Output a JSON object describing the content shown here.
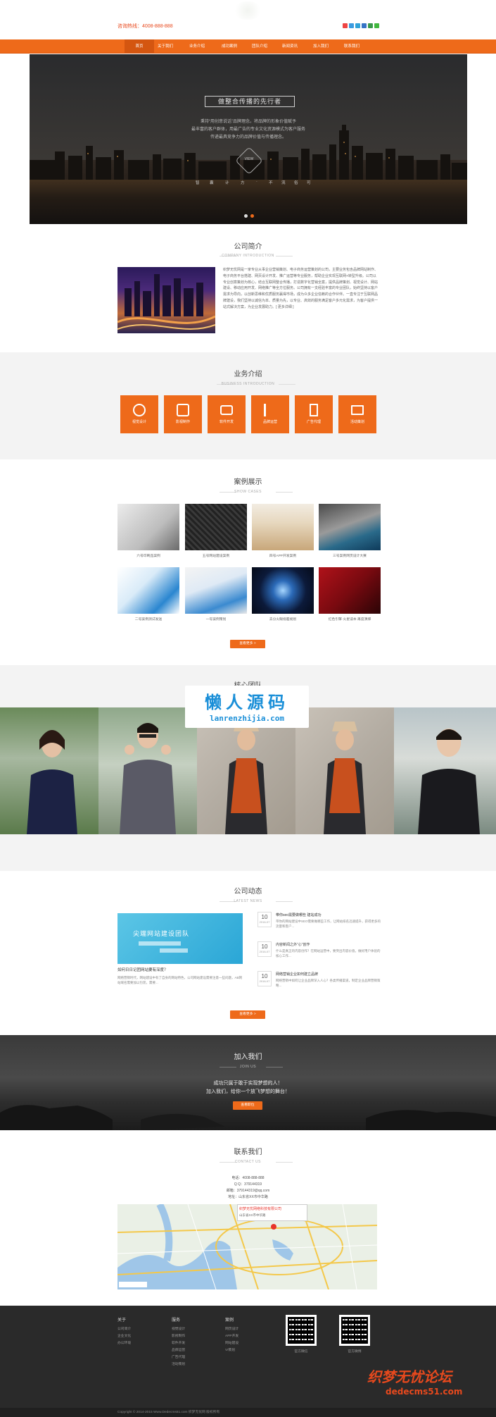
{
  "header": {
    "hotline": "咨询热线：4008-888-888",
    "social_icons": [
      "weibo-icon",
      "qq-icon",
      "tencent-icon",
      "renren-icon",
      "douban-icon",
      "wechat-icon"
    ]
  },
  "nav": {
    "items": [
      "首页",
      "关于我们",
      "业务介绍",
      "成功案例",
      "团队介绍",
      "新闻资讯",
      "加入我们",
      "联系我们"
    ]
  },
  "banner": {
    "title": "做整合传播的先行者",
    "lines": [
      "秉持“用创意说话”品牌理念，将品牌的形象价值赋予",
      "最丰富的客户群体，用最广告的专业文化资源模式为客户服务",
      "传递最具竞争力的品牌价值与传播理念。"
    ],
    "view_label": "VIEW",
    "subline": [
      "智",
      "囊",
      "计",
      "方",
      "·",
      "不",
      "流",
      "俗",
      "可"
    ]
  },
  "intro": {
    "title": "公司简介",
    "subtitle": "COMPANY INTRODUCTION",
    "text": "织梦无忧网是一家专业从事企业营销策划、电子商务运营策划的公司，主要业务包含品牌网站制作、电子商务平台搭建、网页设计开发、推广运营等专业服务，帮助企业实现互联网+转型升级。公司以专业创意策划为核心，结合互联网整合传播，打造数字化营销全案，提供品牌策划、视觉设计、网站建设、移动应用开发、网络推广等全方位服务。公司拥有一支经验丰富的专业团队，始终坚持以客户需求为导向，以创新思维和优质服务赢得市场，成为众多企业信赖的合作伙伴。一直专注于互联网品牌建设，我们坚持以诚信为本、质量为先，以专业、高效的服务满足客户多元化需求，为客户提供一站式解决方案，为企业发展助力。[ 更多详细 ]"
  },
  "services": {
    "title": "业务介绍",
    "subtitle": "BUSINESS INTRODUCTION",
    "items": [
      "视觉设计",
      "影视制作",
      "软件开发",
      "品牌运营",
      "广告代理",
      "活动策划"
    ]
  },
  "cases": {
    "title": "案例展示",
    "subtitle": "SHOW CASES",
    "items": [
      "六号印刷品案例",
      "五号网站建设案例",
      "四号APP开发案例",
      "三号案例网页设计大赛",
      "二号案例测试发送",
      "一号案例策划",
      "去分火眼视差规划",
      "红色引擎·火星读本 再度演绎"
    ],
    "more_button": "查看更多 >"
  },
  "team": {
    "title": "核心团队",
    "watermark_cn": "懒人源码",
    "watermark_en": "lanrenzhijia.com"
  },
  "news": {
    "title": "公司动态",
    "subtitle": "LATEST NEWS",
    "featured_title": "如何日日记团网站要有深度？",
    "featured_body": "网络营销时代，网站建设中有了自身的网站特色，公司网站建设需要注意一些问题，AB网站域名需要加以包装，需要...",
    "featured_banner": "尖端网站建设团队",
    "list": [
      {
        "day": "10",
        "month": "2016-07",
        "head": "带你seo需要做哪些 建站成功",
        "body": "带你的网站建设中SEO需要做哪些工作，让网站排名迅速提升，获得更多的流量和客户..."
      },
      {
        "day": "10",
        "month": "2016-07",
        "head": "内容新闻之外“心”创作",
        "body": "什么是真正的内容创作？在网站运营中，要突出内容价值，做好用户体验的核心工作..."
      },
      {
        "day": "10",
        "month": "2016-07",
        "head": "网络营销企业如何建立品牌",
        "body": "网络营销中如何让企业品牌深入人心？各类传播渠道，制定企业品牌营销策略..."
      }
    ],
    "more_button": "查看更多 >"
  },
  "join": {
    "title": "加入我们",
    "subtitle": "JOIN US",
    "line1": "成功只属于敢于实现梦想的人！",
    "line2": "加入我们，给你一个放飞梦想的舞台！",
    "button": "查看职位"
  },
  "contact": {
    "title": "联系我们",
    "subtitle": "CONTACT US",
    "phone": "电话：4008-888-888",
    "qq": "Q Q：379144319",
    "email": "邮箱：379144319@qq.com",
    "address": "地址：山东省XX市中华路",
    "map_popup_title": "织梦无忧网络科技有限公司",
    "map_popup_addr": "山东省XX市中华路"
  },
  "footer": {
    "columns": [
      {
        "head": "关于",
        "links": [
          "公司简介",
          "企业文化",
          "办公环境"
        ]
      },
      {
        "head": "服务",
        "links": [
          "视觉设计",
          "影视制作",
          "软件开发",
          "品牌运营",
          "广告代理",
          "活动策划"
        ]
      },
      {
        "head": "案例",
        "links": [
          "网页设计",
          "APP开发",
          "网站建设",
          "VI策划"
        ]
      }
    ],
    "qr_labels": [
      "官方微信",
      "官方微博"
    ],
    "copyright": "Copyright © 2014-2015 Www.Dedecms51.com 织梦无忧网 版权所有",
    "watermark_cn": "织梦无忧论坛",
    "watermark_en": "dedecms51.com"
  },
  "colors": {
    "accent": "#ee6a1a",
    "dark": "#2a2a2a",
    "light_bg": "#f3f3f3"
  }
}
